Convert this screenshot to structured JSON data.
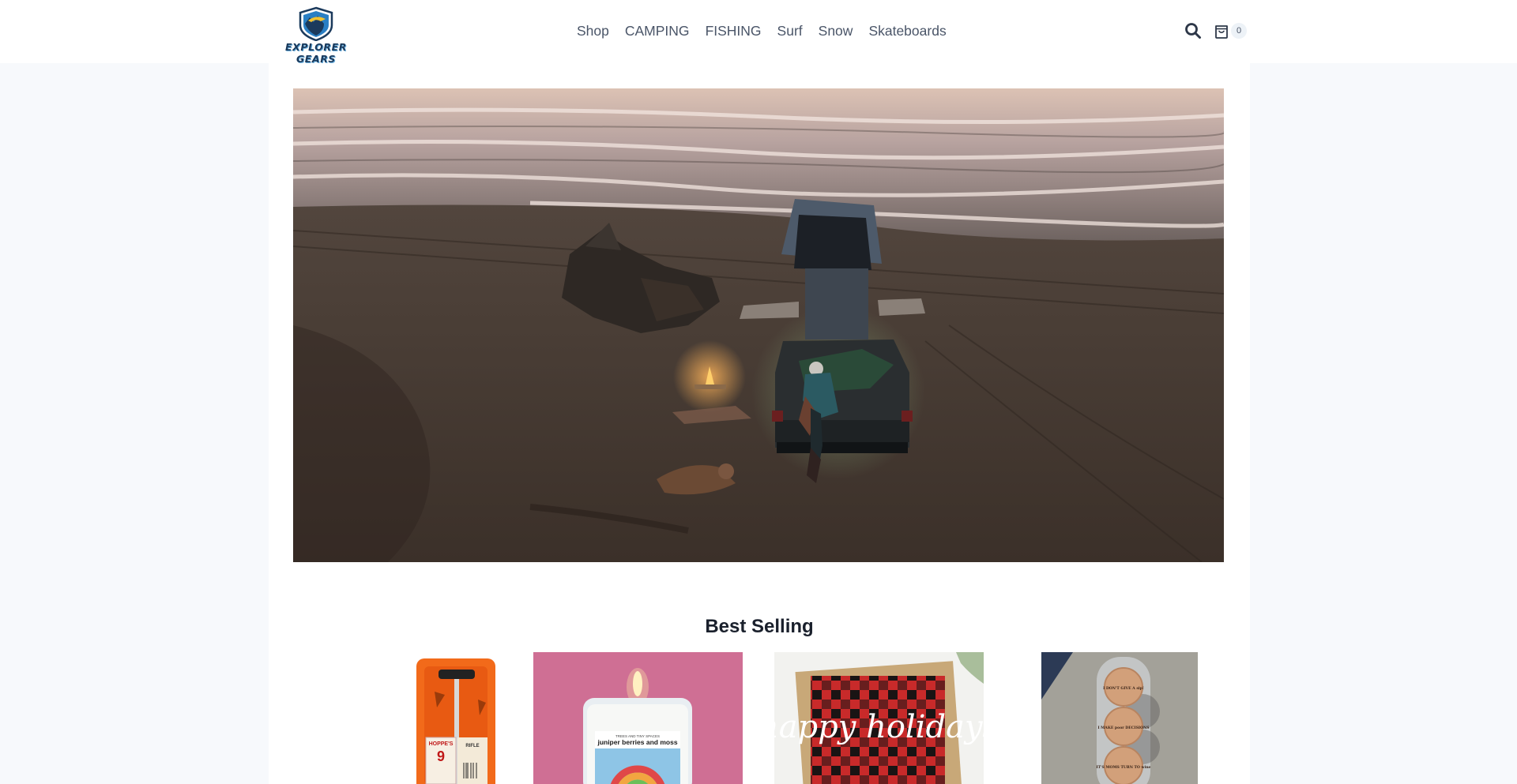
{
  "header": {
    "logo_text": "EXPLORER GEARS",
    "nav": [
      "Shop",
      "CAMPING",
      "FISHING",
      "Surf",
      "Snow",
      "Skateboards"
    ],
    "search_icon": "search-icon",
    "cart_icon": "shopping-bag-icon",
    "cart_count": "0"
  },
  "hero": {
    "image": "beach-camping-truck-photo"
  },
  "best_selling": {
    "title": "Best Selling",
    "products": [
      {
        "image": "hoppes-rifle-cleaning-kit",
        "package_brand": "HOPPE'S",
        "package_number": "9",
        "package_label": "RIFLE"
      },
      {
        "image": "juniper-berries-moss-candle",
        "label_top": "TREES AND TINY SPACES",
        "label": "juniper berries and moss"
      },
      {
        "image": "buffalo-plaid-holiday-card",
        "text": "happy holidays"
      },
      {
        "image": "wooden-coaster-set",
        "coasters": [
          "I DON'T GIVE A sip!",
          "I MAKE poor DECISIONS",
          "IT'S MOMS TURN TO wine"
        ]
      }
    ]
  },
  "colors": {
    "header_bg": "#ffffff",
    "page_bg": "#f7f9fc",
    "nav_text": "#4a5568",
    "title_text": "#1a202c"
  }
}
